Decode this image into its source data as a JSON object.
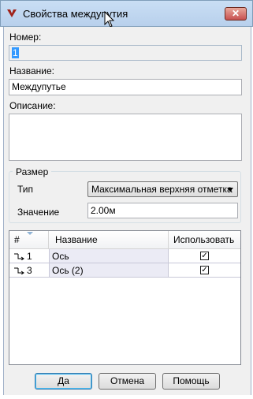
{
  "window": {
    "title": "Свойства междупутия",
    "close_label": "✕"
  },
  "fields": {
    "number_label": "Номер:",
    "number_value": "1",
    "name_label": "Название:",
    "name_value": "Междупутье",
    "description_label": "Описание:",
    "description_value": ""
  },
  "size_group": {
    "title": "Размер",
    "type_label": "Тип",
    "type_value": "Максимальная верхняя отметка",
    "value_label": "Значение",
    "value_value": "2.00м"
  },
  "grid": {
    "columns": [
      "#",
      "Название",
      "Использовать"
    ],
    "rows": [
      {
        "num": "1",
        "name": "Ось",
        "use": true
      },
      {
        "num": "3",
        "name": "Ось (2)",
        "use": true
      }
    ]
  },
  "buttons": {
    "ok": "Да",
    "cancel": "Отмена",
    "help": "Помощь"
  }
}
